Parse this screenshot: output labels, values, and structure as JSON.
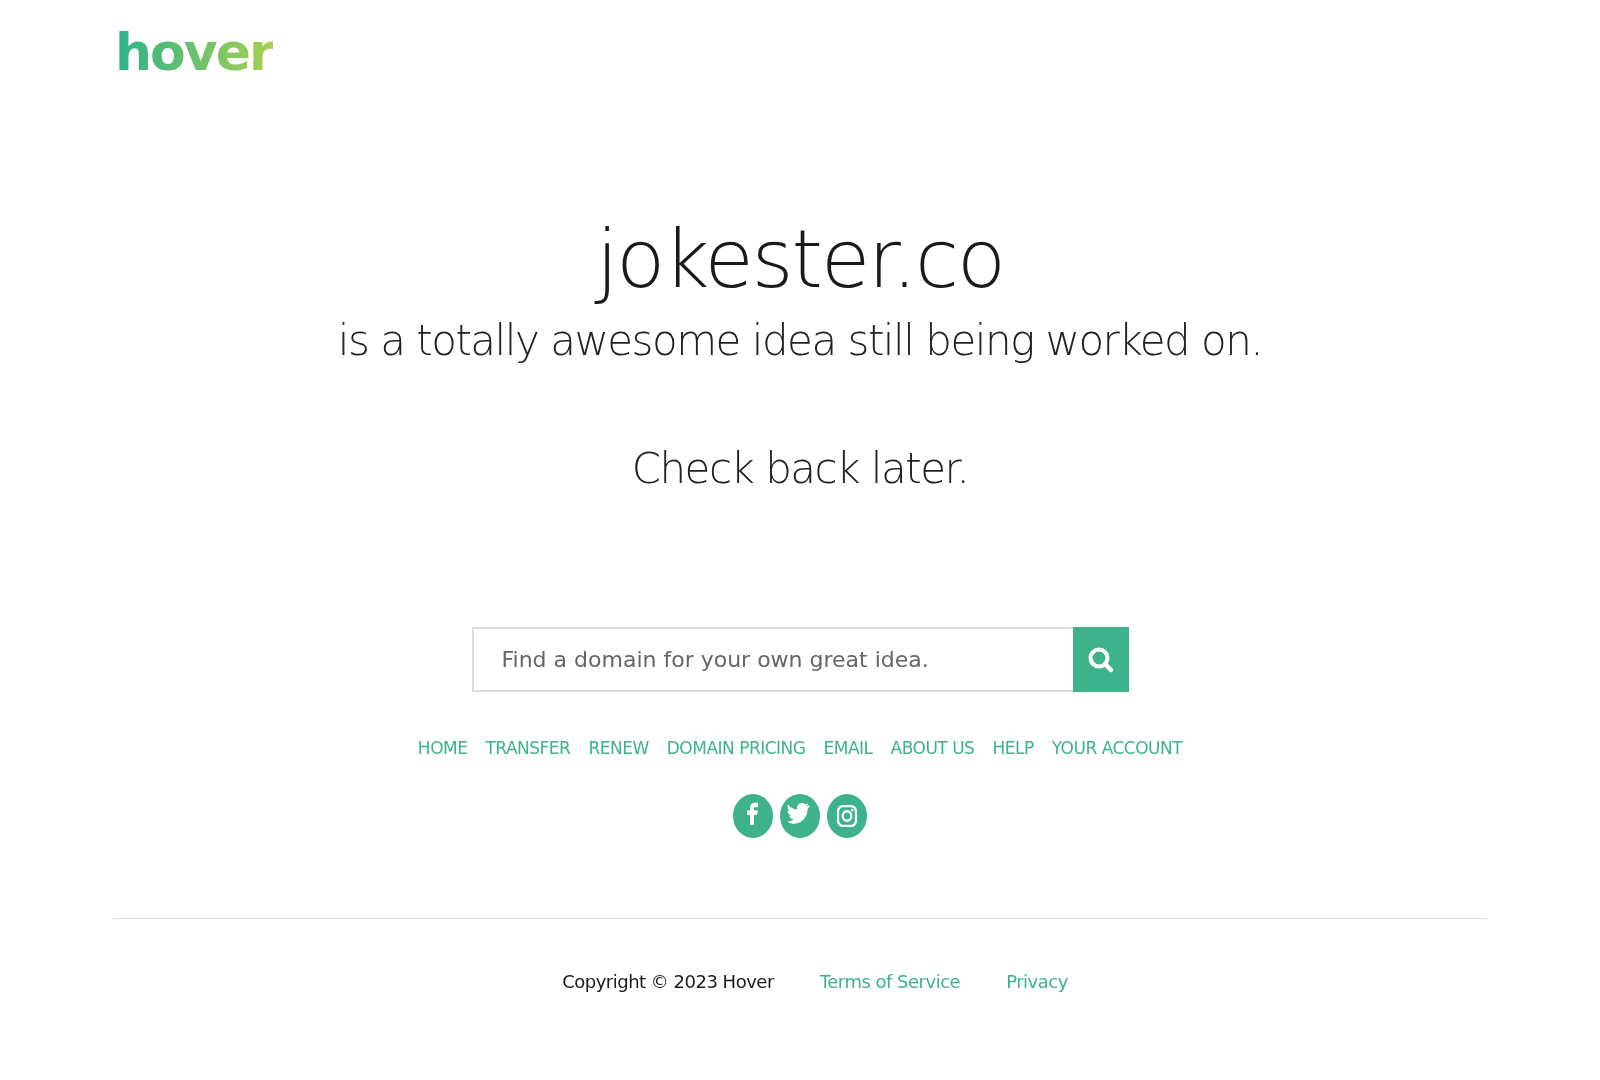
{
  "logo": "hover",
  "domain": "jokester.co",
  "tagline": "is a totally awesome idea still being worked on.",
  "message": "Check back later.",
  "search": {
    "placeholder": "Find a domain for your own great idea."
  },
  "nav": [
    "HOME",
    "TRANSFER",
    "RENEW",
    "DOMAIN PRICING",
    "EMAIL",
    "ABOUT US",
    "HELP",
    "YOUR ACCOUNT"
  ],
  "social": [
    {
      "kind": "facebook"
    },
    {
      "kind": "twitter"
    },
    {
      "kind": "instagram"
    }
  ],
  "footer": {
    "copyright": "Copyright © 2023 Hover",
    "links": [
      "Terms of Service",
      "Privacy"
    ]
  }
}
